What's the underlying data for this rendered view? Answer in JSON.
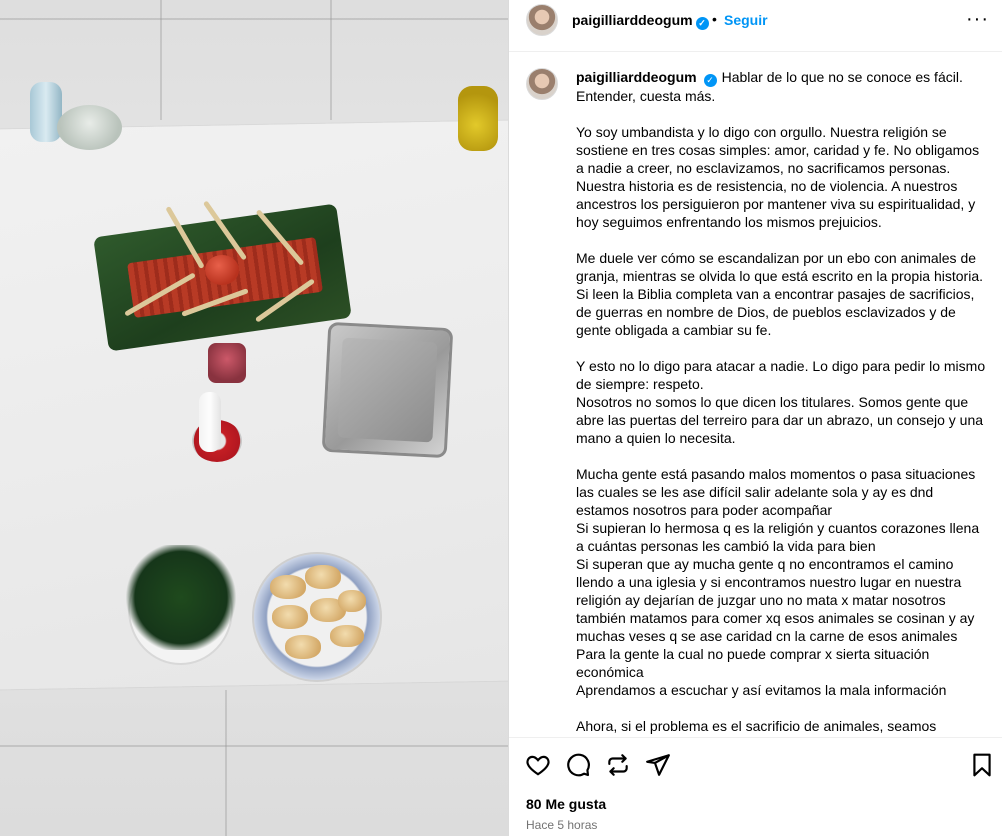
{
  "post": {
    "username": "paigilliarddeogum",
    "follow_label": "Seguir",
    "separator": "•",
    "more_label": "···",
    "likes": "80 Me gusta",
    "time_ago": "Hace 5 horas"
  },
  "caption": {
    "lines": [
      "Hablar de lo que no se conoce es fácil. Entender, cuesta más.",
      "Yo soy umbandista y lo digo con orgullo. Nuestra religión se sostiene en tres cosas simples: amor, caridad y fe. No obligamos a nadie a creer, no esclavizamos, no sacrificamos personas. Nuestra historia es de resistencia, no de violencia. A nuestros ancestros los persiguieron por mantener viva su espiritualidad, y hoy seguimos enfrentando los mismos prejuicios.",
      "Me duele ver cómo se escandalizan por un ebo con animales de granja, mientras se olvida lo que está escrito en la propia historia. Si leen la Biblia completa van a encontrar pasajes de sacrificios, de guerras en nombre de Dios, de pueblos esclavizados y de gente obligada a cambiar su fe.",
      "Y esto no lo digo para atacar a nadie. Lo digo para pedir lo mismo de siempre: respeto.\nNosotros no somos lo que dicen los titulares. Somos gente que abre las puertas del terreiro para dar un abrazo, un consejo y una mano a quien lo necesita.",
      "Mucha gente está pasando malos momentos o pasa situaciones las cuales se les ase difícil salir adelante sola y ay es dnd estamos nosotros para poder acompañar\nSi supieran lo hermosa q es la religión y cuantos corazones llena a cuántas personas les cambió la vida para bien\nSi superan que ay mucha gente q no encontramos el camino llendo a una iglesia y si encontramos nuestro lugar en nuestra religión ay dejarían de juzgar uno no mata x matar nosotros también matamos para comer xq esos animales se cosinan y ay muchas veses q se ase caridad cn la carne de esos animales\nPara la gente la cual no puede comprar x sierta situación económica\nAprendamos a escuchar y así evitamos la mala información",
      "Ahora, si el problema es el sacrificio de animales, seamos"
    ]
  },
  "icons": {
    "like": "heart-icon",
    "comment": "comment-icon",
    "repost": "repost-icon",
    "share": "share-icon",
    "save": "bookmark-icon",
    "more": "more-icon",
    "verified": "verified-badge-icon"
  },
  "colors": {
    "follow_blue": "#0095f6",
    "muted_text": "#737373",
    "border": "#dbdbdb"
  }
}
